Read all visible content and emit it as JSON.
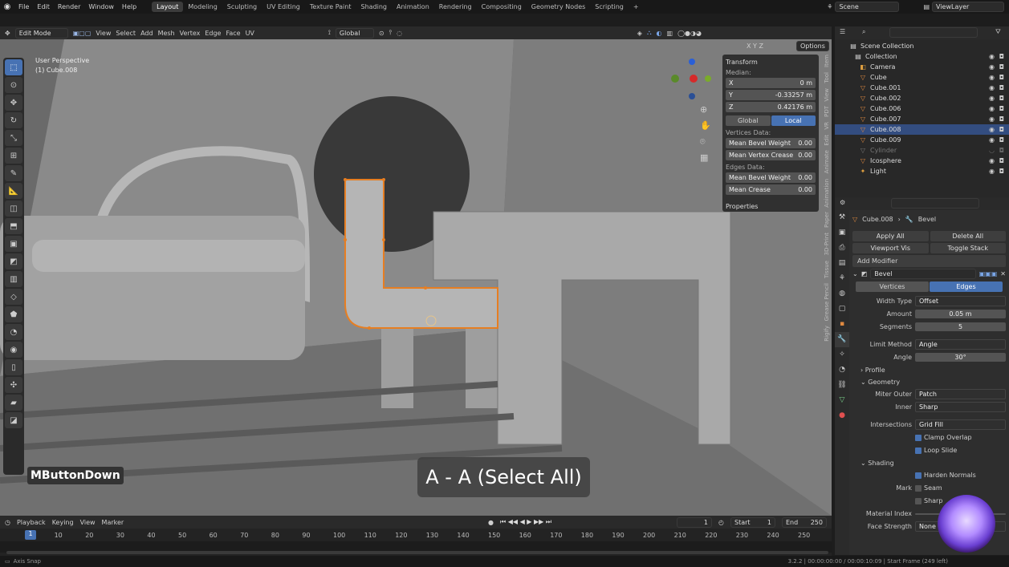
{
  "menu": {
    "items": [
      "File",
      "Edit",
      "Render",
      "Window",
      "Help"
    ]
  },
  "workspaces": [
    "Layout",
    "Modeling",
    "Sculpting",
    "UV Editing",
    "Texture Paint",
    "Shading",
    "Animation",
    "Rendering",
    "Compositing",
    "Geometry Nodes",
    "Scripting"
  ],
  "workspace_plus": "+",
  "scene": "Scene",
  "viewlayer": "ViewLayer",
  "vp": {
    "mode": "Edit Mode",
    "menus": [
      "View",
      "Select",
      "Add",
      "Mesh",
      "Vertex",
      "Edge",
      "Face",
      "UV"
    ],
    "orient": "Global",
    "options": "Options",
    "axes": [
      "X",
      "Y",
      "Z"
    ],
    "perspective": "User Perspective",
    "object": "(1) Cube.008"
  },
  "npanel": {
    "title": "Transform",
    "median": "Median:",
    "x_l": "X",
    "x_v": "0 m",
    "y_l": "Y",
    "y_v": "-0.33257 m",
    "z_l": "Z",
    "z_v": "0.42176 m",
    "global": "Global",
    "local": "Local",
    "vdata": "Vertices Data:",
    "mbw_l": "Mean Bevel Weight",
    "mbw_v": "0.00",
    "mvc_l": "Mean Vertex Crease",
    "mvc_v": "0.00",
    "edata": "Edges Data:",
    "embw_l": "Mean Bevel Weight",
    "embw_v": "0.00",
    "mc_l": "Mean Crease",
    "mc_v": "0.00",
    "props": "Properties"
  },
  "vtabs": [
    "Item",
    "Tool",
    "View",
    "PDT",
    "VR",
    "Edit",
    "Animate",
    "Animation",
    "Paper",
    "3D-Print",
    "Tissue",
    "Grease Pencil",
    "Rigify"
  ],
  "outliner": {
    "root": "Scene Collection",
    "collection": "Collection",
    "items": [
      "Camera",
      "Cube",
      "Cube.001",
      "Cube.002",
      "Cube.006",
      "Cube.007",
      "Cube.008",
      "Cube.009",
      "Cylinder",
      "Icosphere",
      "Light"
    ]
  },
  "props": {
    "crumb_obj": "Cube.008",
    "crumb_mod": "Bevel",
    "apply_all": "Apply All",
    "delete_all": "Delete All",
    "viewport_vis": "Viewport Vis",
    "toggle_stack": "Toggle Stack",
    "add_mod": "Add Modifier",
    "mod_name": "Bevel",
    "vertices": "Vertices",
    "edges": "Edges",
    "width_type_l": "Width Type",
    "width_type_v": "Offset",
    "amount_l": "Amount",
    "amount_v": "0.05 m",
    "segments_l": "Segments",
    "segments_v": "5",
    "limit_l": "Limit Method",
    "limit_v": "Angle",
    "angle_l": "Angle",
    "angle_v": "30°",
    "profile": "Profile",
    "geometry": "Geometry",
    "miter_l": "Miter Outer",
    "miter_v": "Patch",
    "inner_l": "Inner",
    "inner_v": "Sharp",
    "inter_l": "Intersections",
    "inter_v": "Grid Fill",
    "clamp": "Clamp Overlap",
    "loop": "Loop Slide",
    "shading": "Shading",
    "harden": "Harden Normals",
    "mark_l": "Mark",
    "seam": "Seam",
    "sharp": "Sharp",
    "matidx_l": "Material Index",
    "face_l": "Face Strength",
    "face_v": "None"
  },
  "timeline": {
    "playback": "Playback",
    "keying": "Keying",
    "view": "View",
    "marker": "Marker",
    "frame": "1",
    "start_l": "Start",
    "start_v": "1",
    "end_l": "End",
    "end_v": "250",
    "ticks": [
      "10",
      "20",
      "30",
      "40",
      "50",
      "60",
      "70",
      "80",
      "90",
      "100",
      "110",
      "120",
      "130",
      "140",
      "150",
      "160",
      "170",
      "180",
      "190",
      "200",
      "210",
      "220",
      "230",
      "240",
      "250"
    ],
    "cur": "1"
  },
  "status": {
    "left": "Axis Snap",
    "right": "3.2.2 | 00:00:00:00 / 00:00:10:09 | Start Frame (249 left)"
  },
  "overlay": {
    "key": "MButtonDown",
    "hint": "A - A (Select All)"
  },
  "colors": {
    "accent": "#4772b3",
    "select": "#e67e22"
  }
}
